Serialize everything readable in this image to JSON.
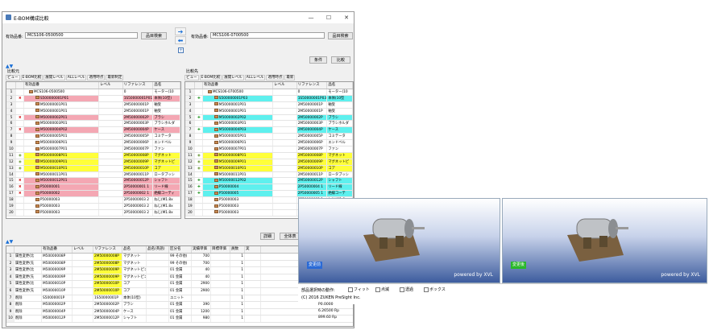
{
  "window": {
    "title": "E-BOM構成比較"
  },
  "left_panel": {
    "part_label": "有効品番:",
    "part_value": "MCS106-0500500",
    "search_btn": "品目検索",
    "section_label": "比較元",
    "tabs": [
      "ビュー",
      "E-BOM比較",
      "展開レベル",
      "ALLレベル",
      "適用時点",
      "最新制定"
    ],
    "headers": [
      "",
      "",
      "有効品番",
      "レベル",
      "リファレンス",
      "品名"
    ],
    "rows": [
      {
        "n": "1",
        "m": "",
        "part": "MCS106-0500500",
        "lvl": "",
        "ref": "0",
        "name": "モーター(10",
        "bg": ""
      },
      {
        "n": "2",
        "m": "x",
        "part": "S500000001P01",
        "lvl": "",
        "ref": "1S50000001P01",
        "name": "本体(10型)",
        "bg": "pink"
      },
      {
        "n": "3",
        "m": "",
        "part": "M50000001P01",
        "lvl": "",
        "ref": "2M50000001P",
        "name": "軸受",
        "bg": ""
      },
      {
        "n": "4",
        "m": "",
        "part": "M50000001P01",
        "lvl": "",
        "ref": "2M50000001P",
        "name": "軸受",
        "bg": ""
      },
      {
        "n": "5",
        "m": "x",
        "part": "M50000002P01",
        "lvl": "",
        "ref": "2M50000002P",
        "name": "ブラシ",
        "bg": "pink"
      },
      {
        "n": "6",
        "m": "",
        "part": "M50000003P01",
        "lvl": "",
        "ref": "2M50000003P",
        "name": "ブラシホルダ",
        "bg": ""
      },
      {
        "n": "7",
        "m": "x",
        "part": "M50000004P02",
        "lvl": "",
        "ref": "2M50000004P",
        "name": "ケース",
        "bg": "pink"
      },
      {
        "n": "8",
        "m": "",
        "part": "M50000005P01",
        "lvl": "",
        "ref": "2M50000005P",
        "name": "コミテータ",
        "bg": ""
      },
      {
        "n": "9",
        "m": "",
        "part": "M50000006P01",
        "lvl": "",
        "ref": "2M50000006P",
        "name": "エンドベル",
        "bg": ""
      },
      {
        "n": "10",
        "m": "",
        "part": "M50000007P01",
        "lvl": "",
        "ref": "2M50000007P",
        "name": "ファン",
        "bg": ""
      },
      {
        "n": "11",
        "m": "c",
        "part": "M50000008P01",
        "lvl": "",
        "ref": "2M50000008P",
        "name": "マグネット",
        "bg": "yel"
      },
      {
        "n": "12",
        "m": "c",
        "part": "M50000009P01",
        "lvl": "",
        "ref": "2M50000009P",
        "name": "マグネットピ",
        "bg": "yel"
      },
      {
        "n": "13",
        "m": "c",
        "part": "M50000010P01",
        "lvl": "",
        "ref": "2M50000010P",
        "name": "コア",
        "bg": "yel"
      },
      {
        "n": "14",
        "m": "",
        "part": "M50000011P01",
        "lvl": "",
        "ref": "2M50000011P",
        "name": "ロータブッシ",
        "bg": ""
      },
      {
        "n": "15",
        "m": "x",
        "part": "M50000012P01",
        "lvl": "",
        "ref": "2M50000012P",
        "name": "シャフト",
        "bg": "pink"
      },
      {
        "n": "16",
        "m": "x",
        "part": "P50000001",
        "lvl": "",
        "ref": "2P50000001 1",
        "name": "リード線",
        "bg": "pink"
      },
      {
        "n": "17",
        "m": "x",
        "part": "P50000002",
        "lvl": "",
        "ref": "2P50000002 1",
        "name": "絶縁コーティ",
        "bg": "pink"
      },
      {
        "n": "18",
        "m": "",
        "part": "P50000003",
        "lvl": "",
        "ref": "2P50000003 2",
        "name": "ねじ(M1.8x",
        "bg": ""
      },
      {
        "n": "19",
        "m": "",
        "part": "P50000003",
        "lvl": "",
        "ref": "2P50000003 2",
        "name": "ねじ(M1.8x",
        "bg": ""
      },
      {
        "n": "20",
        "m": "",
        "part": "P50000003",
        "lvl": "",
        "ref": "2P50000003 2",
        "name": "ねじ(M1.8x",
        "bg": ""
      }
    ]
  },
  "right_panel": {
    "part_label": "有効品番:",
    "part_value": "MCS106-0700500",
    "search_btn": "品目検索",
    "section_label": "比較先",
    "tabs": [
      "ビュー",
      "E-BOM比較",
      "展開レベル",
      "ALLレベル",
      "適用時点",
      "最新"
    ],
    "headers": [
      "",
      "",
      "有効品番",
      "レベル",
      "リファレンス",
      "品名"
    ],
    "rows": [
      {
        "n": "1",
        "m": "",
        "part": "MCS106-0700500",
        "lvl": "",
        "ref": "0",
        "name": "モーター(10",
        "bg": ""
      },
      {
        "n": "2",
        "m": "p",
        "part": "S500000001P03",
        "lvl": "",
        "ref": "1S50000001P03",
        "name": "本体(10型",
        "bg": "cy"
      },
      {
        "n": "3",
        "m": "",
        "part": "M50000001P01",
        "lvl": "",
        "ref": "2M50000001P",
        "name": "軸受",
        "bg": ""
      },
      {
        "n": "4",
        "m": "",
        "part": "M50000001P01",
        "lvl": "",
        "ref": "2M50000001P",
        "name": "軸受",
        "bg": ""
      },
      {
        "n": "5",
        "m": "p",
        "part": "M50000002P02",
        "lvl": "",
        "ref": "2M50000002P",
        "name": "ブラシ",
        "bg": "cy"
      },
      {
        "n": "6",
        "m": "",
        "part": "M50000003P01",
        "lvl": "",
        "ref": "2M50000003P",
        "name": "ブラシホルダ",
        "bg": ""
      },
      {
        "n": "7",
        "m": "p",
        "part": "M50000004P03",
        "lvl": "",
        "ref": "2M50000004P",
        "name": "ケース",
        "bg": "cy"
      },
      {
        "n": "8",
        "m": "",
        "part": "M50000005P01",
        "lvl": "",
        "ref": "2M50000005P",
        "name": "コミテータ",
        "bg": ""
      },
      {
        "n": "9",
        "m": "",
        "part": "M50000006P01",
        "lvl": "",
        "ref": "2M50000006P",
        "name": "エンドベル",
        "bg": ""
      },
      {
        "n": "10",
        "m": "",
        "part": "M50000007P01",
        "lvl": "",
        "ref": "2M50000007P",
        "name": "ファン",
        "bg": ""
      },
      {
        "n": "11",
        "m": "c",
        "part": "M50000008P01",
        "lvl": "",
        "ref": "2M50000008P",
        "name": "マグネット",
        "bg": "yel"
      },
      {
        "n": "12",
        "m": "c",
        "part": "M50000009P01",
        "lvl": "",
        "ref": "2M50000009P",
        "name": "マグネットピ",
        "bg": "yel"
      },
      {
        "n": "13",
        "m": "c",
        "part": "M50000010P01",
        "lvl": "",
        "ref": "2M50000010P",
        "name": "コア",
        "bg": "yel"
      },
      {
        "n": "14",
        "m": "",
        "part": "M50000011P01",
        "lvl": "",
        "ref": "2M50000011P",
        "name": "ロータブッシ",
        "bg": ""
      },
      {
        "n": "15",
        "m": "p",
        "part": "M50000012P02",
        "lvl": "",
        "ref": "2M50000012P",
        "name": "シャフト",
        "bg": "cy"
      },
      {
        "n": "16",
        "m": "p",
        "part": "P50000004",
        "lvl": "",
        "ref": "2P50000004 1",
        "name": "リード線",
        "bg": "cy"
      },
      {
        "n": "17",
        "m": "p",
        "part": "P50000005",
        "lvl": "",
        "ref": "2P50000005 1",
        "name": "絶縁コーテ",
        "bg": "cy"
      },
      {
        "n": "18",
        "m": "",
        "part": "P50000003",
        "lvl": "",
        "ref": "2P50000003 1",
        "name": "ねじ(M1.8x",
        "bg": ""
      },
      {
        "n": "19",
        "m": "",
        "part": "P50000003",
        "lvl": "",
        "ref": "",
        "name": "",
        "bg": ""
      },
      {
        "n": "20",
        "m": "",
        "part": "P50000003",
        "lvl": "",
        "ref": "",
        "name": "",
        "bg": ""
      }
    ]
  },
  "toolbar": {
    "condition_btn": "条件",
    "compare_btn": "比較",
    "detail_btn": "詳細",
    "all_btn": "全体表"
  },
  "diff_table": {
    "headers": [
      "",
      "",
      "有効品番",
      "レベル",
      "リファレンス",
      "品名",
      "品名(英語)",
      "区分名",
      "実績単価",
      "目標単価",
      "員数",
      "実"
    ],
    "rows": [
      {
        "n": "1",
        "type": "属性変更(比",
        "part": "M50000008P",
        "lvl": "",
        "ref": "2M50000008P",
        "name": "マグネット",
        "en": "",
        "cat": "99 その他(",
        "price": "700",
        "target": "",
        "qty": "1",
        "bg": "yel"
      },
      {
        "n": "2",
        "type": "属性変更(先",
        "part": "M50000008P",
        "lvl": "",
        "ref": "2M50000008P",
        "name": "マグネット",
        "en": "",
        "cat": "99 その他(",
        "price": "700",
        "target": "",
        "qty": "1",
        "bg": "yel"
      },
      {
        "n": "3",
        "type": "属性変更(比",
        "part": "M50000009P",
        "lvl": "",
        "ref": "2M50000009P",
        "name": "マグネットピン",
        "en": "",
        "cat": "01 金属",
        "price": "40",
        "target": "",
        "qty": "1",
        "bg": "yel"
      },
      {
        "n": "4",
        "type": "属性変更(先",
        "part": "M50000009P",
        "lvl": "",
        "ref": "2M50000009P",
        "name": "マグネットピン",
        "en": "",
        "cat": "01 金属",
        "price": "40",
        "target": "",
        "qty": "1",
        "bg": "yel"
      },
      {
        "n": "5",
        "type": "属性変更(比",
        "part": "M50000010P",
        "lvl": "",
        "ref": "2M50000010P",
        "name": "コア",
        "en": "",
        "cat": "01 金属",
        "price": "2900",
        "target": "",
        "qty": "1",
        "bg": "yel"
      },
      {
        "n": "6",
        "type": "属性変更(先",
        "part": "M50000010P",
        "lvl": "",
        "ref": "2M50000010P",
        "name": "コア",
        "en": "",
        "cat": "01 金属",
        "price": "2900",
        "target": "",
        "qty": "1",
        "bg": "yel"
      },
      {
        "n": "7",
        "type": "削除",
        "part": "S50000001P",
        "lvl": "",
        "ref": "1S50000001P",
        "name": "本体(10型)",
        "en": "",
        "cat": "ユニット",
        "price": "",
        "target": "",
        "qty": "1",
        "bg": ""
      },
      {
        "n": "8",
        "type": "削除",
        "part": "M50000002P",
        "lvl": "",
        "ref": "2M50000002P",
        "name": "ブラシ",
        "en": "",
        "cat": "01 金属",
        "price": "390",
        "target": "",
        "qty": "1",
        "bg": ""
      },
      {
        "n": "9",
        "type": "削除",
        "part": "M50000004P",
        "lvl": "",
        "ref": "2M50000004P",
        "name": "ケース",
        "en": "",
        "cat": "01 金属",
        "price": "1200",
        "target": "",
        "qty": "1",
        "bg": ""
      },
      {
        "n": "10",
        "type": "削除",
        "part": "M50000012P",
        "lvl": "",
        "ref": "2M50000012P",
        "name": "シャフト",
        "en": "",
        "cat": "01 金属",
        "price": "980",
        "target": "",
        "qty": "1",
        "bg": ""
      }
    ]
  },
  "viewer_left": {
    "label": "変更前",
    "powered": "powered by XVL",
    "label_color": "#2a6ad6"
  },
  "viewer_right": {
    "label": "変更後",
    "powered": "powered by XVL",
    "label_color": "#2ab82a"
  },
  "options": {
    "label": "部品選択時の動作:",
    "items": [
      "フィット",
      "点滅",
      "透過",
      "ボックス"
    ]
  },
  "status": {
    "line1": "(C) 2016 ZUKEN PreSight Inc.",
    "v1": "P0.0000",
    "v2": "6.26500 Rp",
    "v3": "899.60 Rp"
  }
}
